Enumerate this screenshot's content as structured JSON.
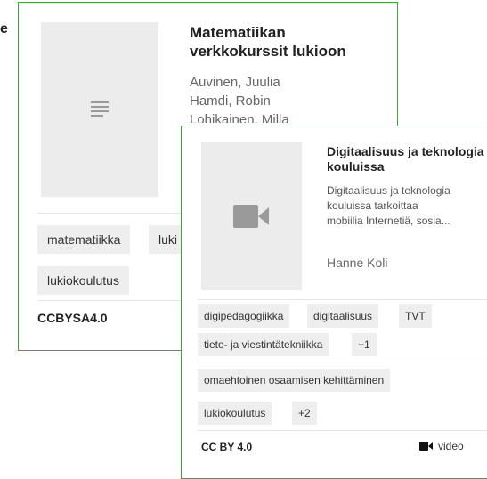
{
  "background_card": {
    "side_letter": "e",
    "title": "Matematiikan verkkokurssit lukioon",
    "authors": [
      "Auvinen, Juulia",
      "Hamdi, Robin",
      "Lohikainen, Milla"
    ],
    "thumbnail_icon": "document-lines-icon",
    "tags": [
      "matematiikka",
      "luki",
      "lukiokoulutus"
    ],
    "license": "CCBYSA4.0"
  },
  "front_card": {
    "title": "Digitaalisuus ja teknologia kouluissa",
    "description_lines": [
      "Digitaalisuus ja teknologia",
      "kouluissa tarkoittaa",
      "mobiilia Internetiä, sosia..."
    ],
    "author": "Hanne Koli",
    "thumbnail_icon": "video-camera-icon",
    "tags": [
      "digipedagogiikka",
      "digitaalisuus",
      "TVT",
      "tieto- ja viestintätekniikka",
      "+1",
      "omaehtoinen osaamisen kehittäminen",
      "lukiokoulutus",
      "+2"
    ],
    "license": "CC BY 4.0",
    "type_icon": "video-icon",
    "type_label": "video"
  },
  "colors": {
    "card_border": "#3aa53a",
    "tag_bg": "#eeeeee",
    "thumb_bg": "#ececec"
  }
}
